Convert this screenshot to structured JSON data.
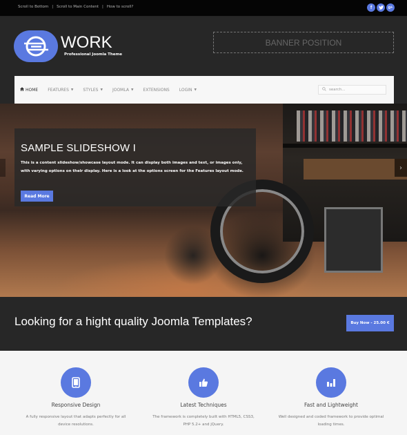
{
  "topbar": {
    "links": [
      "Scroll to Bottom",
      "Scroll to Main Content",
      "How to scroll?"
    ],
    "separator": "|",
    "social": [
      {
        "name": "facebook-icon",
        "glyph": "f"
      },
      {
        "name": "twitter-icon",
        "glyph": "t"
      },
      {
        "name": "google-plus-icon",
        "glyph": "g+"
      }
    ]
  },
  "header": {
    "logo_title": "WORK",
    "logo_subtitle": "Professional Joomla Theme",
    "banner": "BANNER POSITION"
  },
  "nav": {
    "items": [
      {
        "label": "HOME",
        "icon": "home-icon",
        "active": true,
        "dropdown": false
      },
      {
        "label": "FEATURES",
        "dropdown": true
      },
      {
        "label": "STYLES",
        "dropdown": true
      },
      {
        "label": "JOOMLA",
        "dropdown": true
      },
      {
        "label": "EXTENSIONS",
        "dropdown": false
      },
      {
        "label": "LOGIN",
        "dropdown": true
      }
    ],
    "caret": "▼",
    "home_glyph": "⌂",
    "search_placeholder": "search...",
    "search_value": ""
  },
  "slideshow": {
    "title": "SAMPLE SLIDESHOW I",
    "text": "This is a content slideshow/showcase layout mode. It can display both images and text, or images only, with varying options on their display. Here is a look at the options screen for the Features layout mode.",
    "read_more": "Read More",
    "next_glyph": "›"
  },
  "cta": {
    "heading": "Looking for a hight quality Joomla Templates?",
    "button": "Buy Now - 25.00 €"
  },
  "features": [
    {
      "icon": "tablet-icon",
      "title": "Responsive Design",
      "text": "A fully responsive layout that adapts perfectly for all device resolutions."
    },
    {
      "icon": "thumbs-up-icon",
      "title": "Latest Techniques",
      "text": "The framework is completely built with HTML5, CSS3, PHP 5.2+ and jQuery."
    },
    {
      "icon": "bar-chart-icon",
      "title": "Fast and Lightweight",
      "text": "Well designed and coded framework to provide optimal loading times."
    }
  ],
  "colors": {
    "accent": "#5a79e0",
    "dark_bg": "#272727",
    "topbar_bg": "#050505",
    "light_bg": "#f5f5f5"
  }
}
